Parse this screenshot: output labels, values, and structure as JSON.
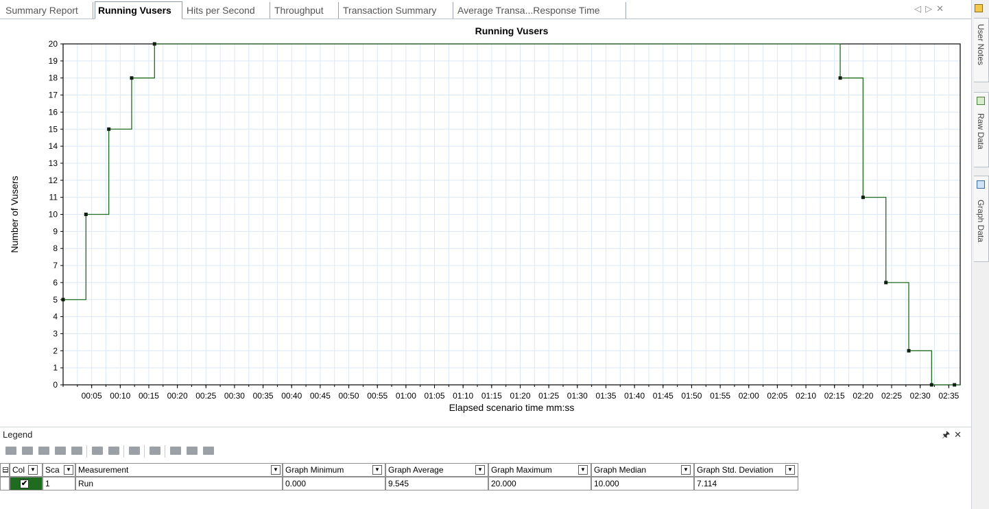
{
  "tabs": [
    {
      "label": "Summary Report",
      "active": false
    },
    {
      "label": "Running Vusers",
      "active": true
    },
    {
      "label": "Hits per Second",
      "active": false
    },
    {
      "label": "Throughput",
      "active": false
    },
    {
      "label": "Transaction Summary",
      "active": false
    },
    {
      "label": "Average Transa...Response Time",
      "active": false
    }
  ],
  "tab_nav": {
    "prev": "◁",
    "next": "▷",
    "close": "✕"
  },
  "side_panel": {
    "tabs": [
      {
        "label": "User Notes",
        "icon": "note-icon"
      },
      {
        "label": "Raw Data",
        "icon": "document-icon"
      },
      {
        "label": "Graph Data",
        "icon": "table-icon"
      }
    ]
  },
  "chart_data": {
    "type": "line",
    "title": "Running Vusers",
    "xlabel": "Elapsed scenario time mm:ss",
    "ylabel": "Number of Vusers",
    "ylim": [
      0,
      20
    ],
    "xlim": [
      0,
      157
    ],
    "grid": true,
    "step": true,
    "yticks": [
      0,
      1,
      2,
      3,
      4,
      5,
      6,
      7,
      8,
      9,
      10,
      11,
      12,
      13,
      14,
      15,
      16,
      17,
      18,
      19,
      20
    ],
    "xticks": [
      "00:05",
      "00:10",
      "00:15",
      "00:20",
      "00:25",
      "00:30",
      "00:35",
      "00:40",
      "00:45",
      "00:50",
      "00:55",
      "01:00",
      "01:05",
      "01:10",
      "01:15",
      "01:20",
      "01:25",
      "01:30",
      "01:35",
      "01:40",
      "01:45",
      "01:50",
      "01:55",
      "02:00",
      "02:05",
      "02:10",
      "02:15",
      "02:20",
      "02:25",
      "02:30",
      "02:35"
    ],
    "series": [
      {
        "name": "Run",
        "color": "#1f6b1f",
        "x": [
          0,
          4,
          8,
          12,
          16,
          136,
          140,
          144,
          148,
          152,
          156
        ],
        "y": [
          5,
          10,
          15,
          18,
          20,
          18,
          11,
          6,
          2,
          0,
          0
        ]
      }
    ]
  },
  "legend": {
    "title": "Legend",
    "pin": "🖈",
    "close": "✕",
    "columns": [
      "Col",
      "Sca",
      "Measurement",
      "Graph Minimum",
      "Graph Average",
      "Graph Maximum",
      "Graph Median",
      "Graph Std. Deviation"
    ],
    "rows": [
      {
        "color": "#1f6b1f",
        "checked": "✔",
        "scale": "1",
        "measurement": "Run",
        "min": "0.000",
        "avg": "9.545",
        "max": "20.000",
        "median": "10.000",
        "std": "7.114"
      }
    ]
  }
}
